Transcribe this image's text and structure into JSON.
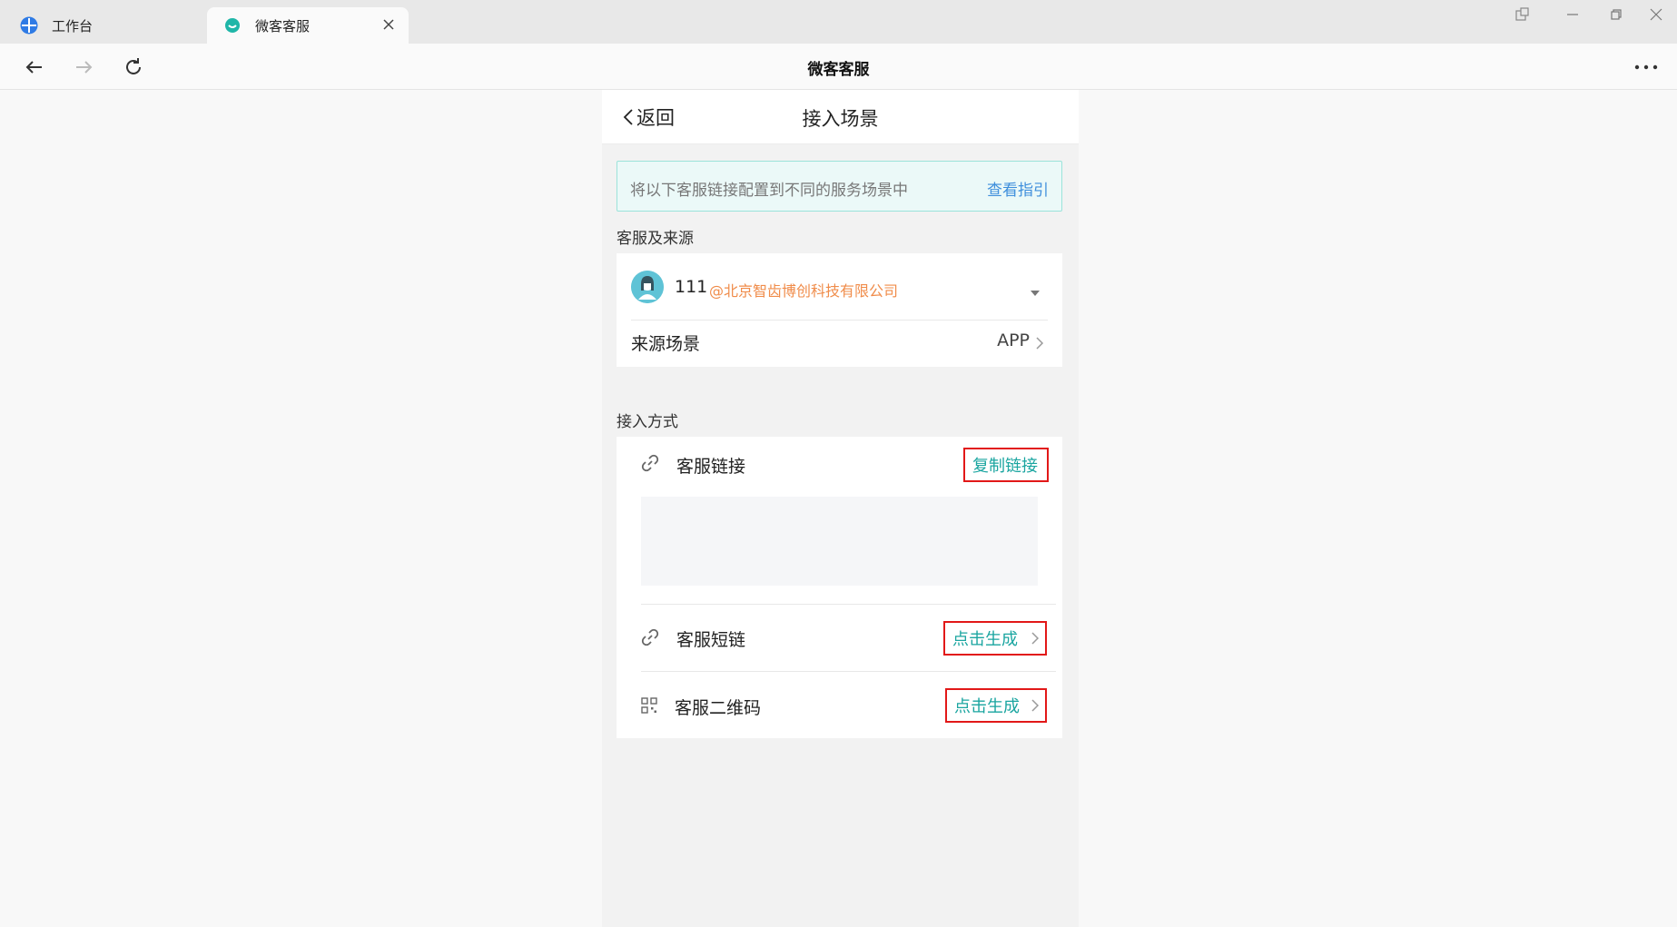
{
  "tabs": [
    {
      "label": "工作台",
      "icon": "workbench-icon"
    },
    {
      "label": "微客客服",
      "icon": "weike-icon"
    }
  ],
  "toolbar": {
    "title": "微客客服"
  },
  "page": {
    "back_label": "返回",
    "title": "接入场景",
    "tip_text": "将以下客服链接配置到不同的服务场景中",
    "tip_link": "查看指引",
    "section_source": "客服及来源",
    "agent_name": "111",
    "agent_org": "@北京智齿博创科技有限公司",
    "source_label": "来源场景",
    "source_value": "APP",
    "section_access": "接入方式",
    "link_label": "客服链接",
    "copy_link": "复制链接",
    "short_link_label": "客服短链",
    "short_link_action": "点击生成",
    "qr_label": "客服二维码",
    "qr_action": "点击生成"
  },
  "colors": {
    "accent": "#1aa5a0",
    "tip_link": "#3f8fdc",
    "org_text": "#f08c4a",
    "highlight_border": "#e21818"
  }
}
